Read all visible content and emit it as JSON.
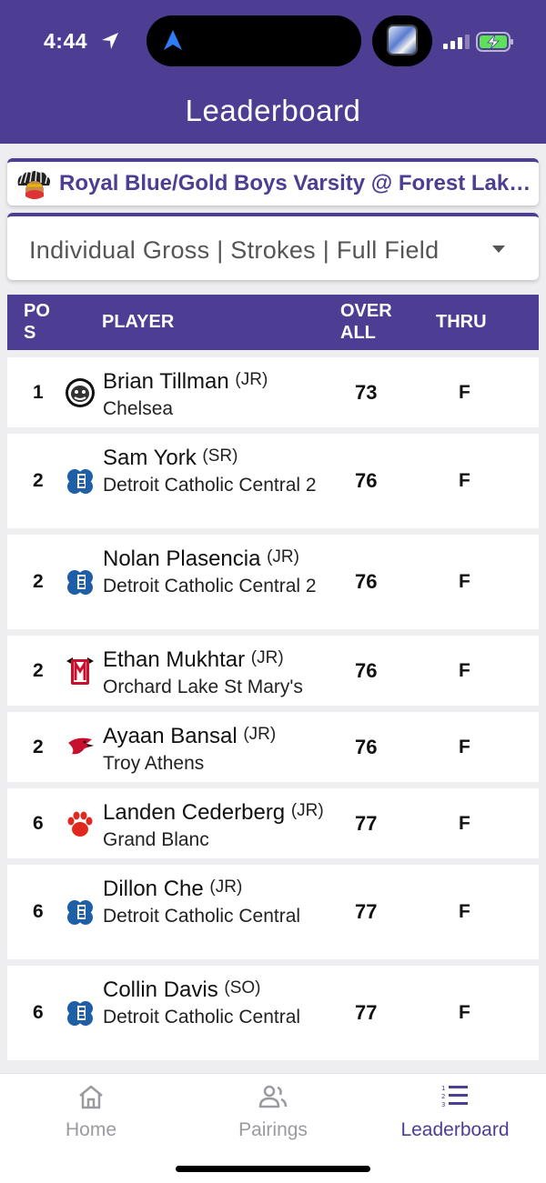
{
  "status_bar": {
    "time": "4:44"
  },
  "header": {
    "title": "Leaderboard"
  },
  "event": {
    "title": "Royal Blue/Gold Boys Varsity @ Forest Lake CC"
  },
  "filter": {
    "value": "Individual Gross | Strokes | Full Field"
  },
  "table": {
    "headers": {
      "pos": "POS",
      "player": "PLAYER",
      "overall": "OVERALL",
      "thru": "THRU"
    },
    "rows": [
      {
        "pos": "1",
        "name": "Brian Tillman",
        "class": "(JR)",
        "team": "Chelsea",
        "score": "73",
        "thru": "F",
        "logo": "bulldog-logo-icon"
      },
      {
        "pos": "2",
        "name": "Sam York",
        "class": "(SR)",
        "team": "Detroit Catholic Central 2",
        "score": "76",
        "thru": "F",
        "logo": "shamrock-logo-icon"
      },
      {
        "pos": "2",
        "name": "Nolan Plasencia",
        "class": "(JR)",
        "team": "Detroit Catholic Central 2",
        "score": "76",
        "thru": "F",
        "logo": "shamrock-logo-icon"
      },
      {
        "pos": "2",
        "name": "Ethan Mukhtar",
        "class": "(JR)",
        "team": "Orchard Lake St Mary's",
        "score": "76",
        "thru": "F",
        "logo": "eaglet-logo-icon"
      },
      {
        "pos": "2",
        "name": "Ayaan Bansal",
        "class": "(JR)",
        "team": "Troy Athens",
        "score": "76",
        "thru": "F",
        "logo": "redhawk-logo-icon"
      },
      {
        "pos": "6",
        "name": "Landen Cederberg",
        "class": "(JR)",
        "team": "Grand Blanc",
        "score": "77",
        "thru": "F",
        "logo": "paw-logo-icon"
      },
      {
        "pos": "6",
        "name": "Dillon Che",
        "class": "(JR)",
        "team": "Detroit Catholic Central",
        "score": "77",
        "thru": "F",
        "logo": "shamrock-logo-icon"
      },
      {
        "pos": "6",
        "name": "Collin Davis",
        "class": "(SO)",
        "team": "Detroit Catholic Central",
        "score": "77",
        "thru": "F",
        "logo": "shamrock-logo-icon"
      }
    ]
  },
  "bottom_nav": [
    {
      "label": "Home",
      "icon": "home-icon",
      "active": false
    },
    {
      "label": "Pairings",
      "icon": "users-icon",
      "active": false
    },
    {
      "label": "Leaderboard",
      "icon": "list-icon",
      "active": true
    }
  ],
  "colors": {
    "brand": "#4d3e93",
    "nav_inactive": "#9a9aa0",
    "background": "#eeeef1"
  }
}
